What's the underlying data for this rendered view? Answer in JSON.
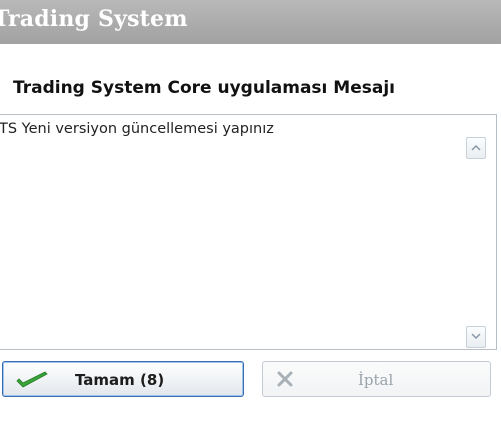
{
  "window": {
    "title": "Trading System"
  },
  "header": {
    "title": "Trading System Core uygulaması Mesajı"
  },
  "message": {
    "text": "TS Yeni versiyon güncellemesi yapınız"
  },
  "buttons": {
    "ok_label": "Tamam (8)",
    "ok_icon": "checkmark-icon",
    "cancel_label": "İptal",
    "cancel_icon": "x-icon"
  },
  "colors": {
    "titlebar": "#acacac",
    "ok_border": "#3a6cb0",
    "check_green": "#3aa33a"
  }
}
